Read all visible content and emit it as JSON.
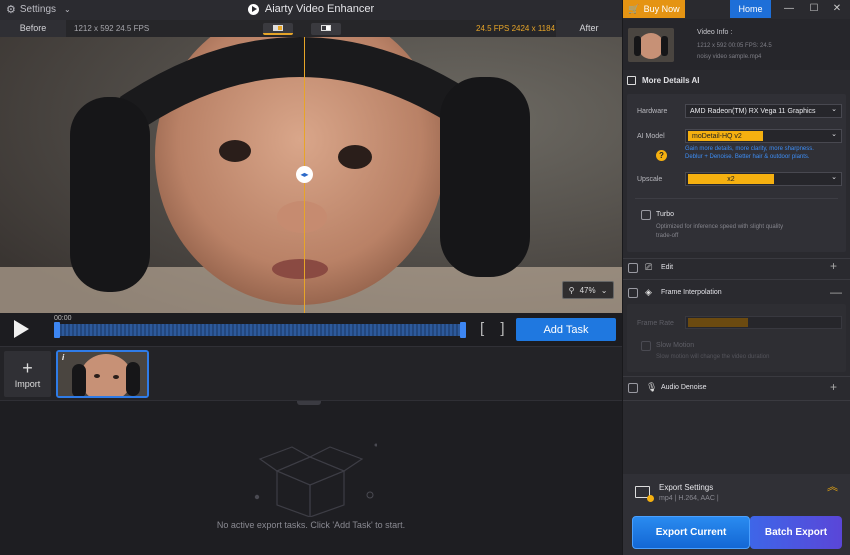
{
  "titlebar": {
    "settings_label": "Settings",
    "app_title": "Aiarty Video Enhancer"
  },
  "compare": {
    "before_label": "Before",
    "after_label": "After",
    "left_info": "1212 x 592  24.5 FPS",
    "right_info": "24.5 FPS  2424 x 1184"
  },
  "preview": {
    "zoom_value": "47%"
  },
  "timeline": {
    "timestamp": "00:00",
    "add_task_label": "Add Task",
    "progress": 0
  },
  "tasks": {
    "import_label": "Import",
    "thumb_badge": "i",
    "empty_message": "No active export tasks. Click 'Add Task' to start."
  },
  "header_right": {
    "buy_now_label": "Buy Now",
    "home_label": "Home"
  },
  "video_info": {
    "title": "Video Info :",
    "details": "1212 x 592  00:05  FPS: 24.5",
    "filename": "noisy video sample.mp4"
  },
  "more_details": {
    "title": "More Details AI",
    "hardware_label": "Hardware",
    "hardware_value": "AMD Radeon(TM) RX Vega 11 Graphics",
    "model_label": "AI Model",
    "model_value": "moDetail-HQ  v2",
    "model_desc_1": "Gain more details, more clarity, more sharpness.",
    "model_desc_2": "Deblur + Denoise. Better hair & outdoor plants.",
    "upscale_label": "Upscale",
    "upscale_value": "x2",
    "turbo_label": "Turbo",
    "turbo_desc_1": "Optimized for inference speed with slight quality",
    "turbo_desc_2": "trade-off"
  },
  "edit": {
    "label": "Edit"
  },
  "frame_interp": {
    "label": "Frame Interpolation",
    "frame_rate_label": "Frame Rate",
    "slow_motion_label": "Slow Motion",
    "slow_motion_desc": "Slow motion will change the video duration"
  },
  "audio": {
    "label": "Audio Denoise"
  },
  "export": {
    "settings_title": "Export Settings",
    "settings_detail": "mp4 | H.264,  AAC |",
    "export_current_label": "Export Current",
    "batch_export_label": "Batch Export"
  },
  "colors": {
    "accent": "#1f78e0",
    "orange": "#e59413",
    "compare_line": "#e7a528"
  }
}
